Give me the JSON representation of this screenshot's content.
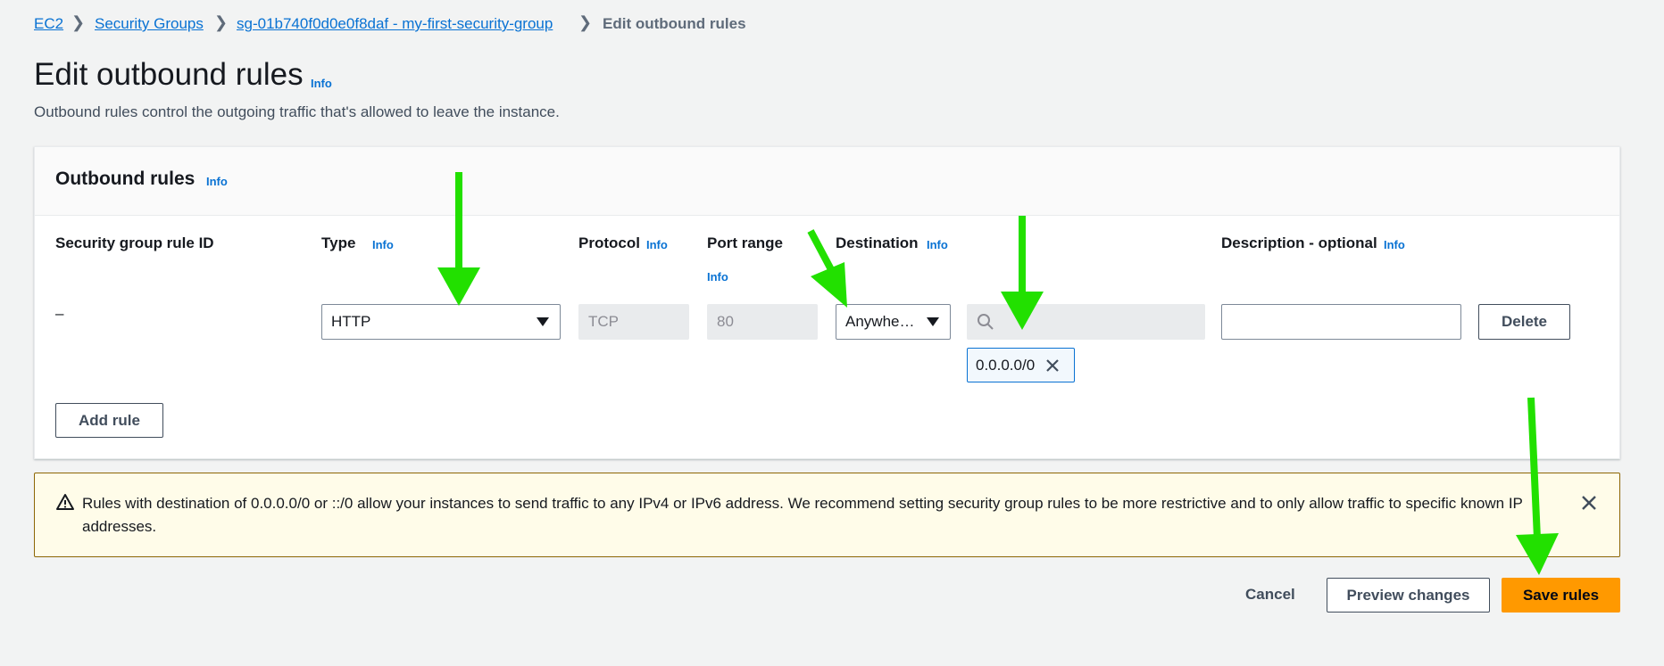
{
  "breadcrumb": {
    "ec2": "EC2",
    "security_groups": "Security Groups",
    "sg": "sg-01b740f0d0e0f8daf - my-first-security-group",
    "current": "Edit outbound rules"
  },
  "page": {
    "title": "Edit outbound rules",
    "info": "Info",
    "description": "Outbound rules control the outgoing traffic that's allowed to leave the instance."
  },
  "panel": {
    "title": "Outbound rules",
    "info": "Info",
    "columns": {
      "rule_id": "Security group rule ID",
      "type": "Type",
      "protocol": "Protocol",
      "port_range": "Port range",
      "destination": "Destination",
      "description": "Description - optional",
      "info": "Info"
    },
    "row": {
      "rule_id": "–",
      "type": "HTTP",
      "protocol": "TCP",
      "port": "80",
      "destination": "Anywhe…",
      "destination_search": "",
      "cidr_token": "0.0.0.0/0",
      "description": "",
      "delete_label": "Delete"
    },
    "add_rule_label": "Add rule"
  },
  "warning": {
    "text": "Rules with destination of 0.0.0.0/0 or ::/0 allow your instances to send traffic to any IPv4 or IPv6 address. We recommend setting security group rules to be more restrictive and to only allow traffic to specific known IP addresses."
  },
  "footer": {
    "cancel": "Cancel",
    "preview": "Preview changes",
    "save": "Save rules"
  },
  "colors": {
    "link": "#0972d3",
    "primary": "#ff9900",
    "warning_bg": "#fffce9",
    "warning_border": "#8d6605",
    "annotation_arrow": "#22e000"
  },
  "icons": [
    "chevron-right-icon",
    "caret-down-icon",
    "search-icon",
    "close-icon",
    "warning-icon",
    "annotation-arrow"
  ]
}
